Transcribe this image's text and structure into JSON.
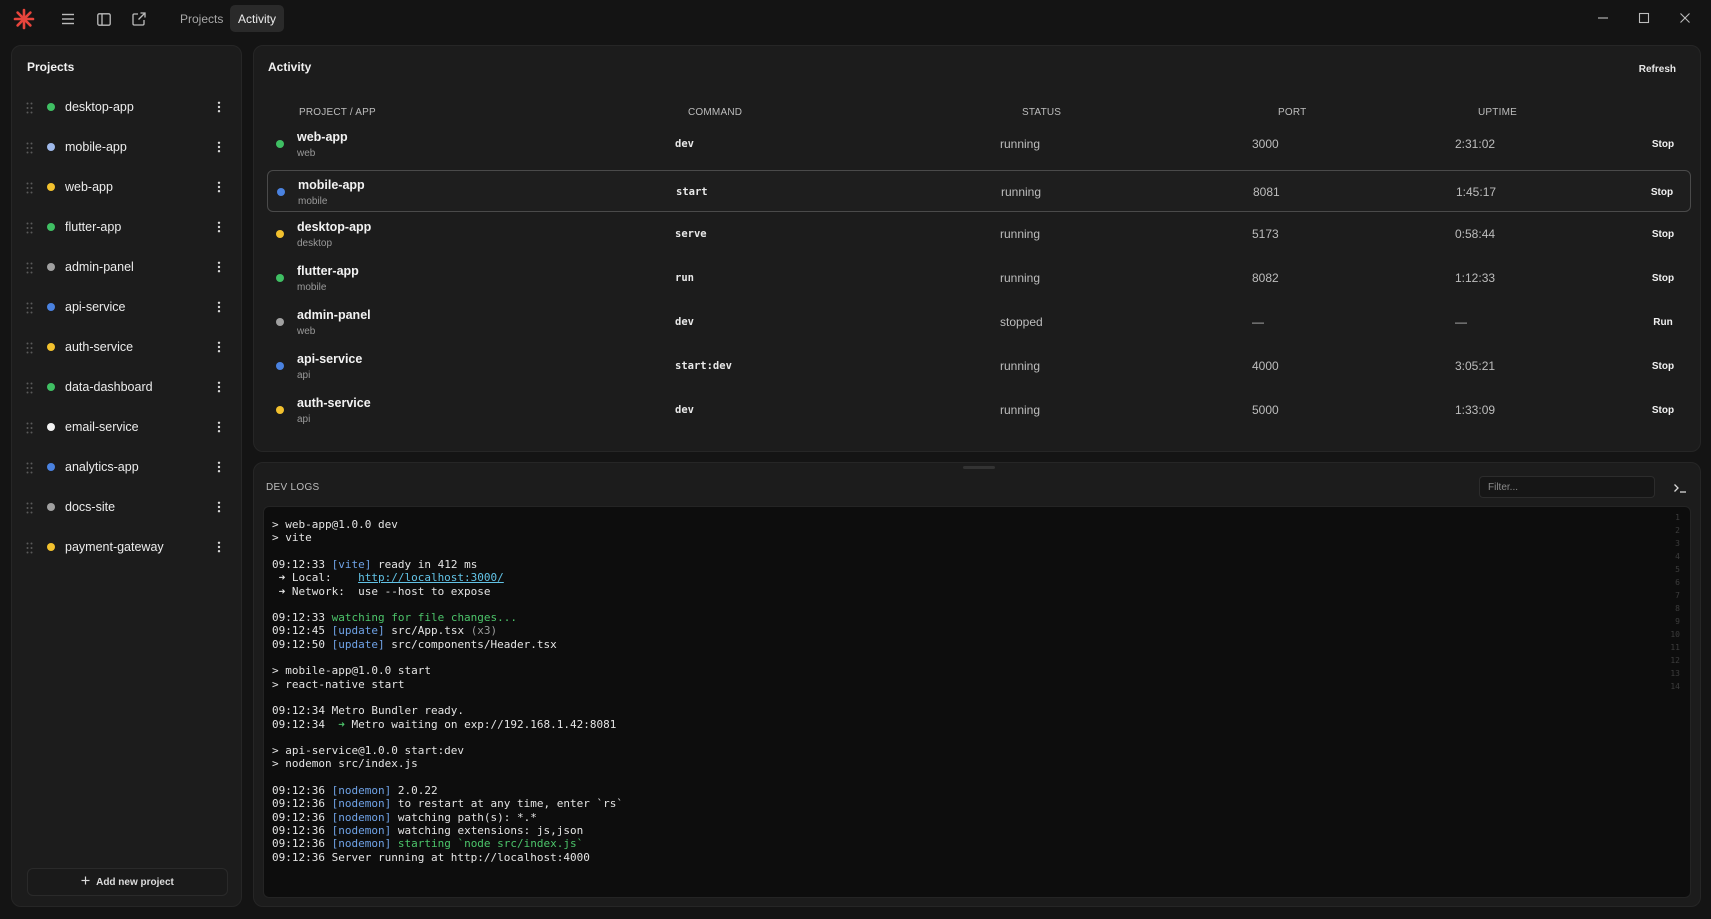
{
  "titlebar": {
    "tabs": [
      {
        "label": "Projects",
        "active": false
      },
      {
        "label": "Activity",
        "active": true
      }
    ]
  },
  "sidebar": {
    "title": "Projects",
    "projects": [
      {
        "name": "desktop-app",
        "color": "#3fbf63"
      },
      {
        "name": "mobile-app",
        "color": "#9fb9ea"
      },
      {
        "name": "web-app",
        "color": "#f2c12e"
      },
      {
        "name": "flutter-app",
        "color": "#3fbf63"
      },
      {
        "name": "admin-panel",
        "color": "#a0a0a0"
      },
      {
        "name": "api-service",
        "color": "#4a82e0"
      },
      {
        "name": "auth-service",
        "color": "#f2c12e"
      },
      {
        "name": "data-dashboard",
        "color": "#3fbf63"
      },
      {
        "name": "email-service",
        "color": "#f2f2f2"
      },
      {
        "name": "analytics-app",
        "color": "#4a82e0"
      },
      {
        "name": "docs-site",
        "color": "#a0a0a0"
      },
      {
        "name": "payment-gateway",
        "color": "#f2c12e"
      }
    ],
    "add_label": "Add new project"
  },
  "activity": {
    "title": "Activity",
    "refresh_label": "Refresh",
    "columns": [
      "PROJECT / APP",
      "COMMAND",
      "STATUS",
      "PORT",
      "UPTIME"
    ],
    "rows": [
      {
        "name": "web-app",
        "sub": "web",
        "command": "dev",
        "status": "running",
        "port": "3000",
        "uptime": "2:31:02",
        "action": "Stop",
        "color": "#3fbf63",
        "selected": false
      },
      {
        "name": "mobile-app",
        "sub": "mobile",
        "command": "start",
        "status": "running",
        "port": "8081",
        "uptime": "1:45:17",
        "action": "Stop",
        "color": "#4a82e0",
        "selected": true
      },
      {
        "name": "desktop-app",
        "sub": "desktop",
        "command": "serve",
        "status": "running",
        "port": "5173",
        "uptime": "0:58:44",
        "action": "Stop",
        "color": "#f2c12e",
        "selected": false
      },
      {
        "name": "flutter-app",
        "sub": "mobile",
        "command": "run",
        "status": "running",
        "port": "8082",
        "uptime": "1:12:33",
        "action": "Stop",
        "color": "#3fbf63",
        "selected": false
      },
      {
        "name": "admin-panel",
        "sub": "web",
        "command": "dev",
        "status": "stopped",
        "port": "—",
        "uptime": "—",
        "action": "Run",
        "color": "#a0a0a0",
        "selected": false
      },
      {
        "name": "api-service",
        "sub": "api",
        "command": "start:dev",
        "status": "running",
        "port": "4000",
        "uptime": "3:05:21",
        "action": "Stop",
        "color": "#4a82e0",
        "selected": false
      },
      {
        "name": "auth-service",
        "sub": "api",
        "command": "dev",
        "status": "running",
        "port": "5000",
        "uptime": "1:33:09",
        "action": "Stop",
        "color": "#f2c12e",
        "selected": false
      }
    ]
  },
  "devlogs": {
    "title": "DEV LOGS",
    "filter_placeholder": "Filter...",
    "gutter": [
      "1",
      "2",
      "3",
      "4",
      "5",
      "6",
      "7",
      "8",
      "9",
      "10",
      "11",
      "12",
      "13",
      "14"
    ],
    "lines": [
      {
        "line": 0,
        "parts": [
          {
            "t": "> web-app@1.0.0 dev"
          }
        ]
      },
      {
        "line": 1,
        "parts": [
          {
            "t": "> vite"
          }
        ]
      },
      {
        "line": 3,
        "parts": [
          {
            "t": "09:12:33 "
          },
          {
            "t": "[vite]",
            "c": "c-blue"
          },
          {
            "t": " ready in 412 ms"
          }
        ]
      },
      {
        "line": 4,
        "parts": [
          {
            "t": " ➜ Local:    "
          },
          {
            "t": "http://localhost:3000/",
            "c": "c-link"
          }
        ]
      },
      {
        "line": 5,
        "parts": [
          {
            "t": " ➜ Network:  use --host to expose"
          }
        ]
      },
      {
        "line": 7,
        "parts": [
          {
            "t": "09:12:33 "
          },
          {
            "t": "watching for file changes...",
            "c": "c-green"
          }
        ]
      },
      {
        "line": 8,
        "parts": [
          {
            "t": "09:12:45 "
          },
          {
            "t": "[update]",
            "c": "c-blue"
          },
          {
            "t": " src/App.tsx "
          },
          {
            "t": "(x3)",
            "c": "c-gray"
          }
        ]
      },
      {
        "line": 9,
        "parts": [
          {
            "t": "09:12:50 "
          },
          {
            "t": "[update]",
            "c": "c-blue"
          },
          {
            "t": " src/components/Header.tsx"
          }
        ]
      },
      {
        "line": 11,
        "parts": [
          {
            "t": "> mobile-app@1.0.0 start"
          }
        ]
      },
      {
        "line": 12,
        "parts": [
          {
            "t": "> react-native start"
          }
        ]
      },
      {
        "line": 14,
        "parts": [
          {
            "t": "09:12:34 Metro Bundler ready."
          }
        ]
      },
      {
        "line": 15,
        "parts": [
          {
            "t": "09:12:34 "
          },
          {
            "t": " ➜",
            "c": "c-green"
          },
          {
            "t": " Metro waiting on exp://192.168.1.42:8081"
          }
        ]
      },
      {
        "line": 17,
        "parts": [
          {
            "t": "> api-service@1.0.0 start:dev"
          }
        ]
      },
      {
        "line": 18,
        "parts": [
          {
            "t": "> nodemon src/index.js"
          }
        ]
      },
      {
        "line": 20,
        "parts": [
          {
            "t": "09:12:36 "
          },
          {
            "t": "[nodemon]",
            "c": "c-blue"
          },
          {
            "t": " 2.0.22"
          }
        ]
      },
      {
        "line": 21,
        "parts": [
          {
            "t": "09:12:36 "
          },
          {
            "t": "[nodemon]",
            "c": "c-blue"
          },
          {
            "t": " to restart at any time, enter `rs`"
          }
        ]
      },
      {
        "line": 22,
        "parts": [
          {
            "t": "09:12:36 "
          },
          {
            "t": "[nodemon]",
            "c": "c-blue"
          },
          {
            "t": " watching path(s): *.*"
          }
        ]
      },
      {
        "line": 23,
        "parts": [
          {
            "t": "09:12:36 "
          },
          {
            "t": "[nodemon]",
            "c": "c-blue"
          },
          {
            "t": " watching extensions: js,json"
          }
        ]
      },
      {
        "line": 24,
        "parts": [
          {
            "t": "09:12:36 "
          },
          {
            "t": "[nodemon]",
            "c": "c-blue"
          },
          {
            "t": " starting `node src/index.js`",
            "c": "c-green"
          }
        ]
      },
      {
        "line": 25,
        "parts": [
          {
            "t": "09:12:36 Server running at http://localhost:4000"
          }
        ]
      }
    ]
  }
}
